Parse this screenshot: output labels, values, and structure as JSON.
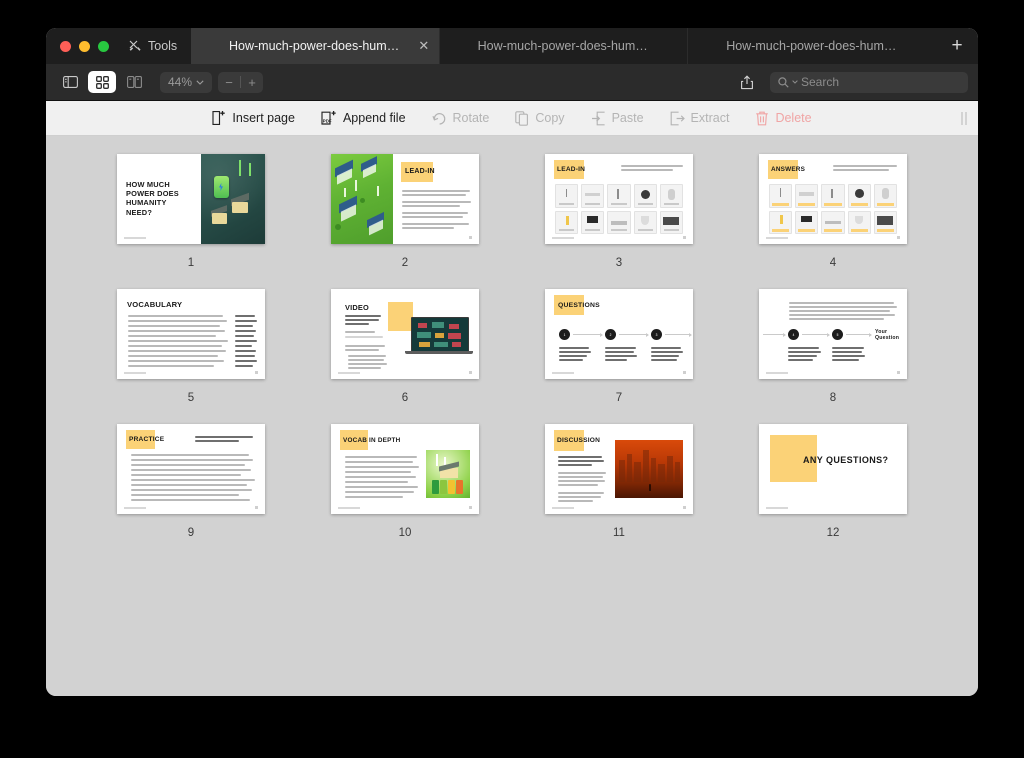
{
  "window": {
    "traffic_lights": [
      "close",
      "minimize",
      "maximize"
    ],
    "tools_label": "Tools"
  },
  "tabs": [
    {
      "label": "How-much-power-does-humanity-n...",
      "active": true,
      "closeable": true
    },
    {
      "label": "How-much-power-does-humanity-ne...",
      "active": false,
      "closeable": false
    },
    {
      "label": "How-much-power-does-humanity-ne...",
      "active": false,
      "closeable": false
    }
  ],
  "new_tab_label": "+",
  "toolbar": {
    "view_buttons": [
      {
        "name": "sidebar-toggle",
        "active": false
      },
      {
        "name": "thumbnail-grid-view",
        "active": true
      },
      {
        "name": "two-page-view",
        "active": false
      }
    ],
    "zoom_level": "44%",
    "zoom_out_label": "−",
    "zoom_in_label": "+",
    "share_icon": "share-icon",
    "search": {
      "placeholder": "Search",
      "value": "",
      "icon": "search-icon"
    }
  },
  "edit_toolbar": {
    "items": [
      {
        "label": "Insert page",
        "icon": "insert-page-icon",
        "enabled": true
      },
      {
        "label": "Append file",
        "icon": "append-file-icon",
        "enabled": true
      },
      {
        "label": "Rotate",
        "icon": "rotate-icon",
        "enabled": false
      },
      {
        "label": "Copy",
        "icon": "copy-icon",
        "enabled": false
      },
      {
        "label": "Paste",
        "icon": "paste-icon",
        "enabled": false
      },
      {
        "label": "Extract",
        "icon": "extract-icon",
        "enabled": false
      },
      {
        "label": "Delete",
        "icon": "trash-icon",
        "enabled": false,
        "danger": true
      }
    ]
  },
  "colors": {
    "accent_yellow": "#fbd277",
    "canvas_gray": "#d2d2d2",
    "titlebar": "#1e1e1e",
    "toolbar": "#2b2b2b",
    "edit_toolbar": "#f0f0f0",
    "delete_red": "#f0a5a5"
  },
  "pages": [
    {
      "number": "1",
      "kind": "title",
      "title": "HOW MUCH POWER DOES HUMANITY NEED?"
    },
    {
      "number": "2",
      "kind": "lead-in-city",
      "title": "LEAD-IN"
    },
    {
      "number": "3",
      "kind": "appliances",
      "title": "LEAD-IN"
    },
    {
      "number": "4",
      "kind": "answers",
      "title": "ANSWERS"
    },
    {
      "number": "5",
      "kind": "vocabulary",
      "title": "VOCABULARY"
    },
    {
      "number": "6",
      "kind": "video",
      "title": "VIDEO"
    },
    {
      "number": "7",
      "kind": "questions",
      "title": "QUESTIONS"
    },
    {
      "number": "8",
      "kind": "questions2",
      "title": ""
    },
    {
      "number": "9",
      "kind": "practice",
      "title": "PRACTICE"
    },
    {
      "number": "10",
      "kind": "vocab-depth",
      "title": "VOCAB IN DEPTH"
    },
    {
      "number": "11",
      "kind": "discussion",
      "title": "DISCUSSION"
    },
    {
      "number": "12",
      "kind": "closing",
      "title": "ANY QUESTIONS?"
    }
  ]
}
